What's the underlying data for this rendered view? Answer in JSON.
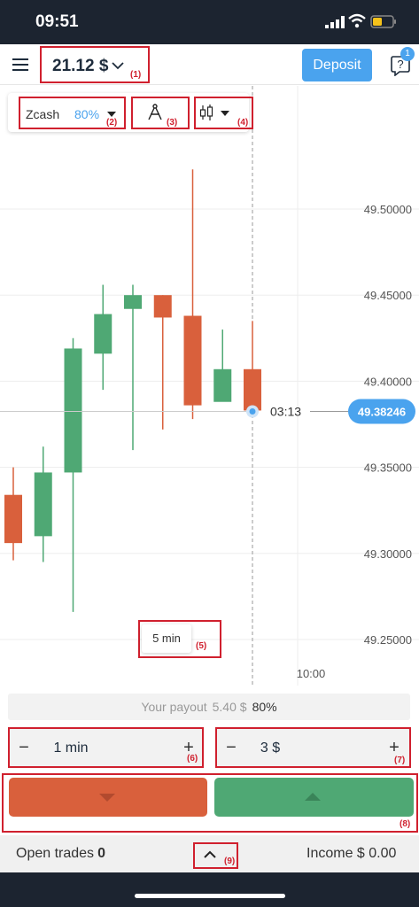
{
  "status_bar": {
    "time": "09:51"
  },
  "header": {
    "balance": "21.12 $",
    "deposit_label": "Deposit",
    "help_badge": "1"
  },
  "annotations": {
    "a1": "(1)",
    "a2": "(2)",
    "a3": "(3)",
    "a4": "(4)",
    "a5": "(5)",
    "a6": "(6)",
    "a7": "(7)",
    "a8": "(8)",
    "a9": "(9)"
  },
  "toolbar": {
    "asset_name": "Zcash",
    "asset_payout": "80%"
  },
  "chart": {
    "current_price": "49.38246",
    "countdown": "03:13",
    "time_label": "10:00",
    "timeframe": "5 min",
    "colors": {
      "up": "#4fa874",
      "down": "#d9603c",
      "accent": "#4aa3ee"
    }
  },
  "chart_data": {
    "type": "candlestick",
    "y_ticks": [
      "49.50000",
      "49.45000",
      "49.40000",
      "49.35000",
      "49.30000",
      "49.25000"
    ],
    "ylim": [
      49.22,
      49.53
    ],
    "x_tick_labels": [
      "10:00"
    ],
    "candles": [
      {
        "open": 49.306,
        "close": 49.334,
        "high": 49.35,
        "low": 49.296,
        "dir": "down"
      },
      {
        "open": 49.31,
        "close": 49.347,
        "high": 49.362,
        "low": 49.295,
        "dir": "up"
      },
      {
        "open": 49.347,
        "close": 49.419,
        "high": 49.425,
        "low": 49.266,
        "dir": "up"
      },
      {
        "open": 49.416,
        "close": 49.439,
        "high": 49.456,
        "low": 49.395,
        "dir": "up"
      },
      {
        "open": 49.442,
        "close": 49.45,
        "high": 49.456,
        "low": 49.36,
        "dir": "up"
      },
      {
        "open": 49.45,
        "close": 49.437,
        "high": 49.45,
        "low": 49.372,
        "dir": "down"
      },
      {
        "open": 49.438,
        "close": 49.386,
        "high": 49.523,
        "low": 49.378,
        "dir": "down"
      },
      {
        "open": 49.407,
        "close": 49.388,
        "high": 49.43,
        "low": 49.389,
        "dir": "up"
      },
      {
        "open": 49.407,
        "close": 49.383,
        "high": 49.435,
        "low": 49.383,
        "dir": "down"
      }
    ]
  },
  "trade": {
    "payout_label": "Your payout",
    "payout_value": "5.40 $",
    "payout_pct": "80%",
    "duration": "1 min",
    "amount": "3 $",
    "minus": "−",
    "plus": "+"
  },
  "bottom": {
    "open_trades_label": "Open trades",
    "open_trades_count": "0",
    "income_label": "Income",
    "income_value": "$ 0.00"
  }
}
